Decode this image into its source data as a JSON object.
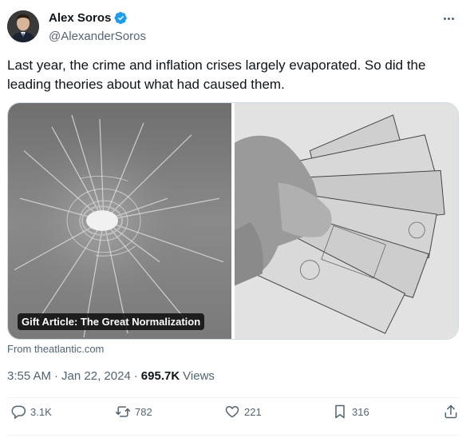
{
  "author": {
    "display_name": "Alex Soros",
    "handle": "@AlexanderSoros",
    "verified": true,
    "verified_color": "#1d9bf0"
  },
  "tweet": {
    "text": "Last year, the crime and inflation crises largely evaporated. So did the leading theories about what had caused them."
  },
  "media": {
    "left_image": "shattered-glass-bullet-hole-photo",
    "right_image": "hand-holding-dollar-bills-photo",
    "article_label": "Gift Article: The Great Normalization",
    "source": "From theatlantic.com"
  },
  "meta": {
    "time": "3:55 AM",
    "separator": "·",
    "date": "Jan 22, 2024",
    "views_count": "695.7K",
    "views_label": "Views"
  },
  "actions": {
    "replies": "3.1K",
    "reposts": "782",
    "likes": "221",
    "bookmarks": "316"
  },
  "icons": {
    "more": "more-options-icon",
    "reply": "reply-icon",
    "repost": "repost-icon",
    "like": "heart-icon",
    "bookmark": "bookmark-icon",
    "share": "share-icon"
  }
}
